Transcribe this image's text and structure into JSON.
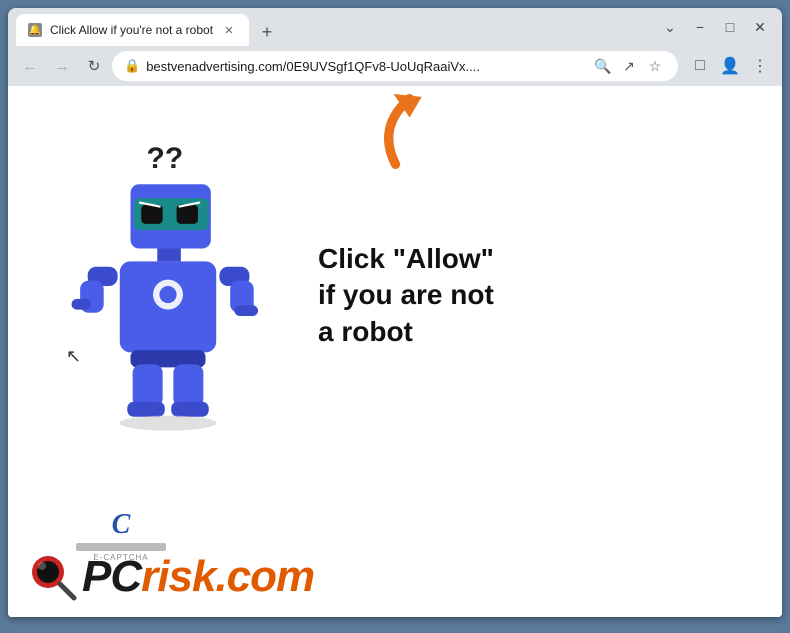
{
  "browser": {
    "tab": {
      "label": "Click Allow if you're not a robot",
      "favicon": "🔔"
    },
    "window_controls": {
      "minimize": "–",
      "maximize": "□",
      "close": "✕",
      "chevron": "⌄"
    },
    "nav": {
      "back": "←",
      "forward": "→",
      "reload": "↻"
    },
    "url": "bestvenadvertising.com/0E9UVSgf1QFv8-UoUqRaaiVx....",
    "url_icons": {
      "search": "🔍",
      "share": "↗",
      "star": "☆",
      "extensions": "□",
      "profile": "👤",
      "more": "⋮"
    },
    "new_tab": "+"
  },
  "page": {
    "message_line1": "Click \"Allow\"",
    "message_line2": "if you are not",
    "message_line3": "a robot"
  },
  "watermark": {
    "pc_text": "PC",
    "risk_text": "risk",
    "dot_com": ".com",
    "ecaptcha_letter": "C",
    "ecaptcha_label": "E-CAPTCHA"
  },
  "colors": {
    "orange_arrow": "#e8731a",
    "robot_blue": "#4a5de8",
    "robot_dark_blue": "#2a3aaa",
    "robot_teal": "#2ab8b8",
    "accent_orange": "#e05a00",
    "tab_bg": "#ffffff",
    "browser_chrome": "#dee1e6"
  }
}
